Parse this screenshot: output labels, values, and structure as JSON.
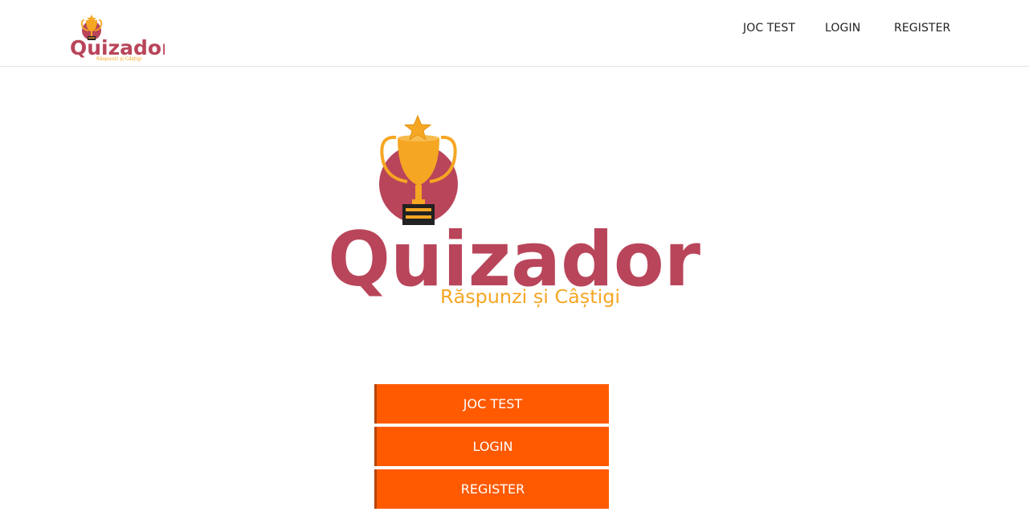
{
  "brand": {
    "name": "Quizador",
    "tagline": "Răspunzi și Câștigi",
    "colors": {
      "primary": "#b9455a",
      "gold": "#f5a623",
      "accent": "#ff5a00"
    }
  },
  "nav": {
    "links": [
      {
        "label": "JOC TEST"
      },
      {
        "label": "LOGIN"
      },
      {
        "label": "REGISTER"
      }
    ]
  },
  "actions": {
    "buttons": [
      {
        "label": "JOC TEST"
      },
      {
        "label": "LOGIN"
      },
      {
        "label": "REGISTER"
      }
    ]
  }
}
